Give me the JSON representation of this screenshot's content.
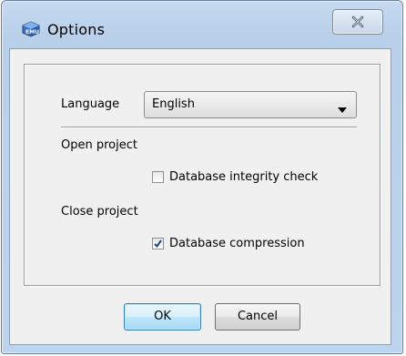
{
  "window": {
    "title": "Options",
    "app_icon": "app-cube-icon",
    "close_icon": "close-icon"
  },
  "form": {
    "language_label": "Language",
    "language_value": "English",
    "language_dropdown_icon": "chevron-down-icon",
    "open_project_label": "Open project",
    "integrity_check_label": "Database integrity check",
    "integrity_check_checked": false,
    "close_project_label": "Close project",
    "compression_label": "Database compression",
    "compression_checked": true
  },
  "buttons": {
    "ok_label": "OK",
    "cancel_label": "Cancel"
  },
  "colors": {
    "title_bar": "#b9d0ea",
    "dialog_body": "#f0f0f0",
    "default_button_border": "#3c7fb1",
    "check_mark": "#1f3f8a"
  }
}
